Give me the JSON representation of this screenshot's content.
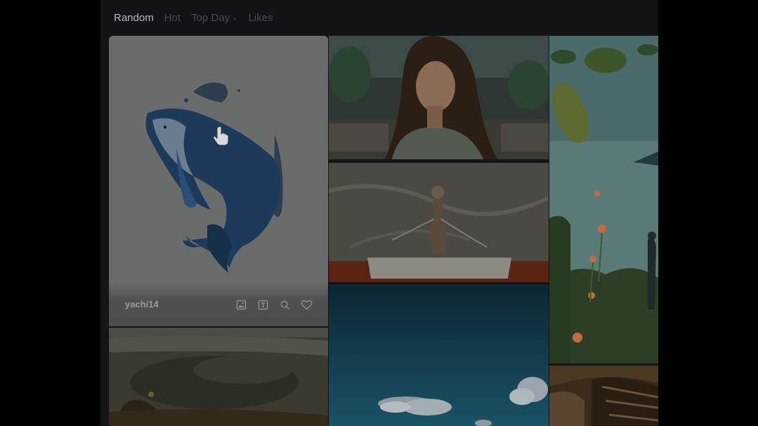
{
  "nav": {
    "tabs": [
      {
        "label": "Random",
        "active": true
      },
      {
        "label": "Hot",
        "active": false
      },
      {
        "label": "Top Day",
        "active": false,
        "has_dropdown": true
      },
      {
        "label": "Likes",
        "active": false
      }
    ]
  },
  "featured_card": {
    "author": "yachi14",
    "actions": [
      "image-icon",
      "text-icon",
      "search-icon",
      "heart-icon"
    ]
  },
  "colors": {
    "background": "#000000",
    "panel": "#141419",
    "active_tab": "#b9b9bf",
    "inactive_tab": "#4b4b52"
  }
}
